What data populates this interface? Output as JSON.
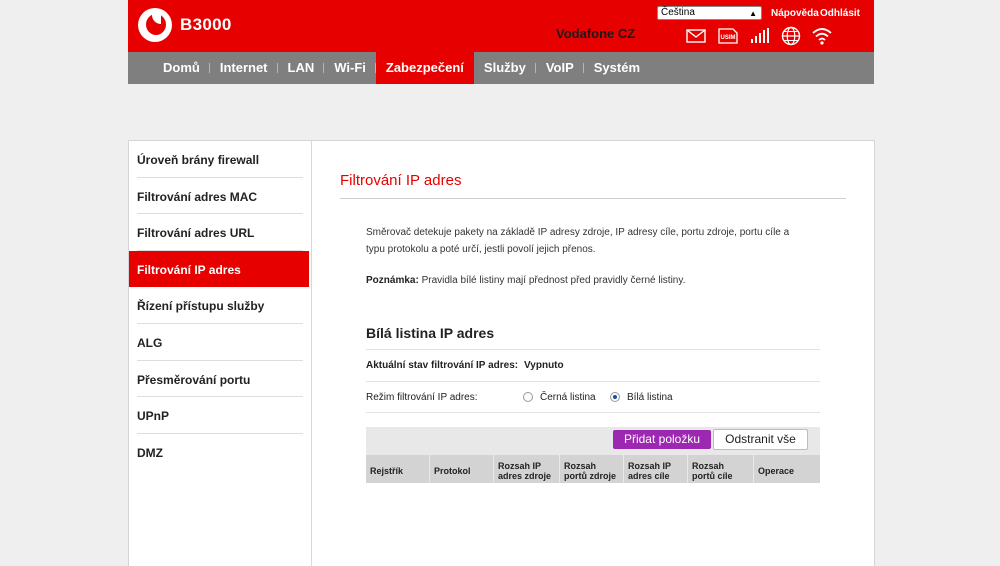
{
  "header": {
    "brand": "B3000",
    "operator": "Vodafone CZ",
    "language": "Čeština",
    "help_link": "Nápověda",
    "logout_link": "Odhlásit",
    "status_icons": [
      "mail-icon",
      "usim-icon",
      "signal-icon",
      "globe-icon",
      "wifi-icon"
    ],
    "usim_label": "USIM"
  },
  "nav": {
    "items": [
      "Domů",
      "Internet",
      "LAN",
      "Wi-Fi",
      "Zabezpečení",
      "Služby",
      "VoIP",
      "Systém"
    ],
    "active": "Zabezpečení"
  },
  "sidebar": {
    "items": [
      "Úroveň brány firewall",
      "Filtrování adres MAC",
      "Filtrování adres URL",
      "Filtrování IP adres",
      "Řízení přístupu služby",
      "ALG",
      "Přesměrování portu",
      "UPnP",
      "DMZ"
    ],
    "active": "Filtrování IP adres"
  },
  "main": {
    "title": "Filtrování IP adres",
    "description": "Směrovač detekuje pakety na základě IP adresy zdroje, IP adresy cíle, portu zdroje, portu cíle a typu protokolu a poté určí, jestli povolí jejich přenos.",
    "note_label": "Poznámka:",
    "note_text": " Pravidla bílé listiny mají přednost před pravidly černé listiny.",
    "section_title": "Bílá listina IP adres",
    "status_label": "Aktuální stav filtrování IP adres:",
    "status_value": "Vypnuto",
    "mode_label": "Režim filtrování IP adres:",
    "mode_options": [
      "Černá listina",
      "Bílá listina"
    ],
    "mode_selected": "Bílá listina",
    "add_button": "Přidat položku",
    "remove_button": "Odstranit vše",
    "table_headers": [
      "Rejstřík",
      "Protokol",
      "Rozsah IP adres zdroje",
      "Rozsah portů zdroje",
      "Rozsah IP adres cíle",
      "Rozsah portů cíle",
      "Operace"
    ]
  },
  "colors": {
    "brand_red": "#e60000",
    "nav_gray": "#7f7f7f",
    "add_button_purple": "#9c27b0",
    "radio_selected": "#1a4fa0"
  }
}
